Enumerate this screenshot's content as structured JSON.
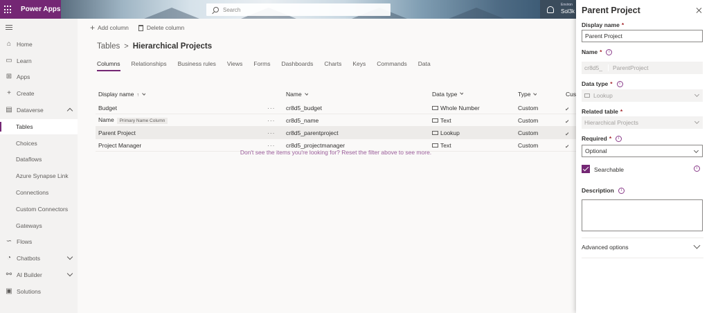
{
  "app": {
    "title": "Power Apps"
  },
  "search": {
    "placeholder": "Search"
  },
  "environment": {
    "label": "Environ",
    "value": "Sol3k"
  },
  "sidebar": {
    "items": [
      {
        "label": "Home",
        "icon": "home-icon"
      },
      {
        "label": "Learn",
        "icon": "book-icon"
      },
      {
        "label": "Apps",
        "icon": "apps-icon"
      },
      {
        "label": "Create",
        "icon": "plus-icon"
      },
      {
        "label": "Dataverse",
        "icon": "database-icon"
      },
      {
        "label": "Tables"
      },
      {
        "label": "Choices"
      },
      {
        "label": "Dataflows"
      },
      {
        "label": "Azure Synapse Link"
      },
      {
        "label": "Connections"
      },
      {
        "label": "Custom Connectors"
      },
      {
        "label": "Gateways"
      },
      {
        "label": "Flows",
        "icon": "flow-icon"
      },
      {
        "label": "Chatbots",
        "icon": "chatbot-icon"
      },
      {
        "label": "AI Builder",
        "icon": "ai-icon"
      },
      {
        "label": "Solutions",
        "icon": "solutions-icon"
      }
    ]
  },
  "commands": {
    "add_column": "Add column",
    "delete_column": "Delete column"
  },
  "breadcrumb": {
    "root": "Tables",
    "separator": ">",
    "current": "Hierarchical Projects"
  },
  "tabs": [
    "Columns",
    "Relationships",
    "Business rules",
    "Views",
    "Forms",
    "Dashboards",
    "Charts",
    "Keys",
    "Commands",
    "Data"
  ],
  "table": {
    "headers": {
      "display_name": "Display name",
      "sort_arrow": "↑",
      "name": "Name",
      "data_type": "Data type",
      "type": "Type",
      "custom": "Cust"
    },
    "rows": [
      {
        "display_name": "Budget",
        "badge": "",
        "more": "···",
        "name": "cr8d5_budget",
        "data_type": "Whole Number",
        "type": "Custom"
      },
      {
        "display_name": "Name",
        "badge": "Primary Name Column",
        "more": "···",
        "name": "cr8d5_name",
        "data_type": "Text",
        "type": "Custom"
      },
      {
        "display_name": "Parent Project",
        "badge": "",
        "more": "···",
        "name": "cr8d5_parentproject",
        "data_type": "Lookup",
        "type": "Custom"
      },
      {
        "display_name": "Project Manager",
        "badge": "",
        "more": "···",
        "name": "cr8d5_projectmanager",
        "data_type": "Text",
        "type": "Custom"
      }
    ],
    "empty_message": "Don't see the items you're looking for? Reset the filter above to see more."
  },
  "panel": {
    "title": "Parent Project",
    "display_name_label": "Display name",
    "display_name_value": "Parent Project",
    "name_label": "Name",
    "name_prefix": "cr8d5_",
    "name_value": "ParentProject",
    "data_type_label": "Data type",
    "data_type_value": "Lookup",
    "related_table_label": "Related table",
    "related_table_value": "Hierarchical Projects",
    "required_label": "Required",
    "required_value": "Optional",
    "searchable_label": "Searchable",
    "description_label": "Description",
    "advanced_label": "Advanced options",
    "required_marker": "*",
    "info_glyph": "i"
  },
  "colors": {
    "brand": "#742774",
    "required": "#a4262c",
    "link": "#9b5d9b"
  }
}
